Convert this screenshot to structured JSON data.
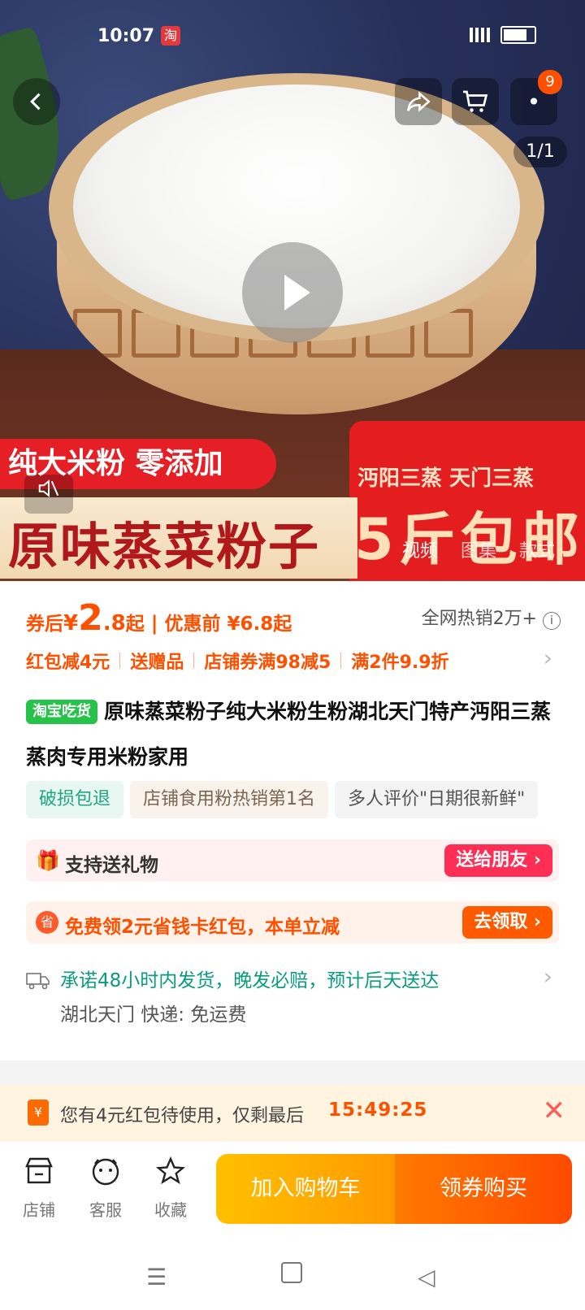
{
  "status_bar": {
    "time": "10:07",
    "app_badge": "淘"
  },
  "hero": {
    "page_indicator": "1/1",
    "cart_count": "9",
    "banner_red": "纯大米粉 零添加",
    "banner_main": "原味蒸菜粉子",
    "banner_sub": "沔阳三蒸 天门三蒸",
    "banner_big": "5斤包邮",
    "media_tabs": [
      "视频",
      "图集",
      "款式"
    ]
  },
  "price": {
    "prefix": "券后",
    "currency": "¥",
    "amount_big": "2",
    "amount_small": ".8",
    "suffix": "起",
    "separator": "|",
    "original": "优惠前 ¥6.8起",
    "sales": "全网热销2万+"
  },
  "promos": [
    "红包减4元",
    "送赠品",
    "店铺券满98减5",
    "满2件9.9折"
  ],
  "title": {
    "tag": "淘宝吃货",
    "text": "原味蒸菜粉子纯大米粉生粉湖北天门特产沔阳三蒸蒸肉专用米粉家用"
  },
  "chips": [
    "破损包退",
    "店铺食用粉热销第1名",
    "多人评价\"日期很新鲜\""
  ],
  "gift": {
    "label": "支持送礼物",
    "button": "送给朋友 ›"
  },
  "coupon": {
    "icon": "省",
    "label": "免费领2元省钱卡红包，本单立减",
    "button": "去领取 ›"
  },
  "shipping": {
    "promise": "承诺48小时内发货，晚发必赔，预计后天送达",
    "origin": "湖北天门  快递: 免运费"
  },
  "notice": {
    "icon": "¥",
    "text": "您有4元红包待使用，仅剩最后",
    "countdown": "15:49:25"
  },
  "bottom_bar": {
    "store": "店铺",
    "service": "客服",
    "favorite": "收藏",
    "add_cart": "加入购物车",
    "buy": "领券购买"
  }
}
